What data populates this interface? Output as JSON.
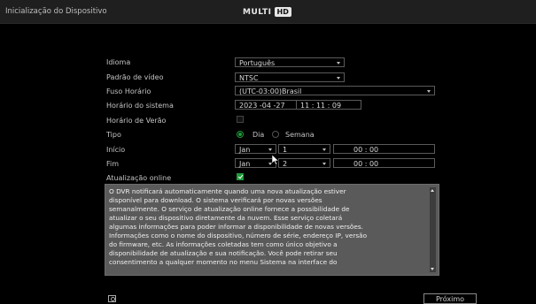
{
  "window": {
    "title": "Inicialização do Dispositivo"
  },
  "brand": {
    "logo_text": "MULTI",
    "logo_badge": "HD"
  },
  "form": {
    "language": {
      "label": "Idioma",
      "value": "Português"
    },
    "video_standard": {
      "label": "Padrão de vídeo",
      "value": "NTSC"
    },
    "timezone": {
      "label": "Fuso Horário",
      "value": "(UTC-03:00)Brasil"
    },
    "system_time": {
      "label": "Horário do sistema",
      "date": "2023 -04 -27",
      "time": "11 : 11 : 09"
    },
    "dst": {
      "label": "Horário de Verão",
      "checked": false
    },
    "type": {
      "label": "Tipo",
      "options": [
        "Dia",
        "Semana"
      ],
      "selected": "Dia"
    },
    "start": {
      "label": "Início",
      "month": "Jan",
      "day": "1",
      "time": "00 : 00"
    },
    "end": {
      "label": "Fim",
      "month": "Jan",
      "day": "2",
      "time": "00 : 00"
    },
    "online_update": {
      "label": "Atualização online",
      "checked": true
    }
  },
  "notice": {
    "lines": [
      "O DVR notificará automaticamente quando uma nova atualização estiver",
      "disponível para download. O sistema verificará por novas versões",
      "semanalmente. O serviço de atualização online fornece a possibilidade de",
      "atualizar o seu dispositivo diretamente da nuvem. Esse serviço coletará",
      "algumas informações para poder informar a disponibilidade de novas versões.",
      "Informações como o nome do dispositivo, número de série, endereço IP, versão",
      "do firmware, etc. As informações coletadas tem como único objetivo a",
      "disponibilidade de atualização e sua notificação. Você pode retirar seu",
      "consentimento a qualquer momento no menu Sistema na interface do"
    ]
  },
  "footer": {
    "next_label": "Próximo"
  },
  "colors": {
    "accent": "#1f9a3a",
    "panel": "#5a5a5a"
  }
}
